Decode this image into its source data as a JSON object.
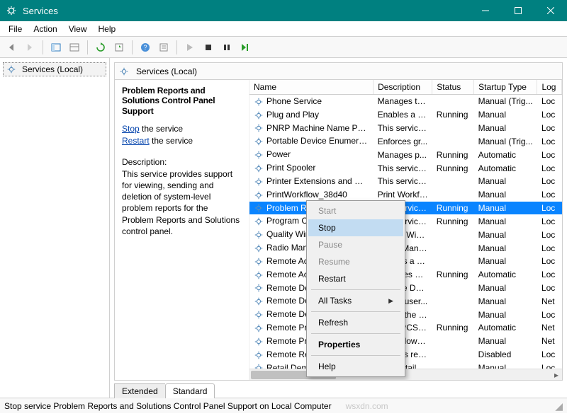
{
  "window": {
    "title": "Services"
  },
  "menus": {
    "file": "File",
    "action": "Action",
    "view": "View",
    "help": "Help"
  },
  "left": {
    "label": "Services (Local)"
  },
  "panel_header": "Services (Local)",
  "tabs": {
    "extended": "Extended",
    "standard": "Standard"
  },
  "desc": {
    "title": "Problem Reports and Solutions Control Panel Support",
    "stop_link": "Stop",
    "stop_suffix": " the service",
    "restart_link": "Restart",
    "restart_suffix": " the service",
    "label": "Description:",
    "text": "This service provides support for viewing, sending and deletion of system-level problem reports for the Problem Reports and Solutions control panel."
  },
  "columns": {
    "name": "Name",
    "description": "Description",
    "status": "Status",
    "startup": "Startup Type",
    "logon": "Log"
  },
  "context": {
    "start": "Start",
    "stop": "Stop",
    "pause": "Pause",
    "resume": "Resume",
    "restart": "Restart",
    "alltasks": "All Tasks",
    "refresh": "Refresh",
    "properties": "Properties",
    "help": "Help"
  },
  "status_text": "Stop service Problem Reports and Solutions Control Panel Support on Local Computer",
  "services": [
    {
      "name": "Phone Service",
      "desc": "Manages th...",
      "status": "",
      "startup": "Manual (Trig...",
      "logon": "Loc"
    },
    {
      "name": "Plug and Play",
      "desc": "Enables a c...",
      "status": "Running",
      "startup": "Manual",
      "logon": "Loc"
    },
    {
      "name": "PNRP Machine Name Publi...",
      "desc": "This service ...",
      "status": "",
      "startup": "Manual",
      "logon": "Loc"
    },
    {
      "name": "Portable Device Enumerator...",
      "desc": "Enforces gr...",
      "status": "",
      "startup": "Manual (Trig...",
      "logon": "Loc"
    },
    {
      "name": "Power",
      "desc": "Manages p...",
      "status": "Running",
      "startup": "Automatic",
      "logon": "Loc"
    },
    {
      "name": "Print Spooler",
      "desc": "This service ...",
      "status": "Running",
      "startup": "Automatic",
      "logon": "Loc"
    },
    {
      "name": "Printer Extensions and Notif...",
      "desc": "This service ...",
      "status": "",
      "startup": "Manual",
      "logon": "Loc"
    },
    {
      "name": "PrintWorkflow_38d40",
      "desc": "Print Workfl...",
      "status": "",
      "startup": "Manual",
      "logon": "Loc"
    },
    {
      "name": "Problem Reports and Soluti...",
      "desc": "This service ...",
      "status": "Running",
      "startup": "Manual",
      "logon": "Loc"
    },
    {
      "name": "Program Compatibility Assi...",
      "desc": "This service ...",
      "status": "Running",
      "startup": "Manual",
      "logon": "Loc"
    },
    {
      "name": "Quality Windows Audio Vid...",
      "desc": "Quality Win...",
      "status": "",
      "startup": "Manual",
      "logon": "Loc"
    },
    {
      "name": "Radio Management Service",
      "desc": "Radio Mana...",
      "status": "",
      "startup": "Manual",
      "logon": "Loc"
    },
    {
      "name": "Remote Access Auto Conne...",
      "desc": "Creates a co...",
      "status": "",
      "startup": "Manual",
      "logon": "Loc"
    },
    {
      "name": "Remote Access Connection...",
      "desc": "Manages di...",
      "status": "Running",
      "startup": "Automatic",
      "logon": "Loc"
    },
    {
      "name": "Remote Desktop Configurat...",
      "desc": "Remote Des...",
      "status": "",
      "startup": "Manual",
      "logon": "Loc"
    },
    {
      "name": "Remote Desktop Services",
      "desc": "Allows user...",
      "status": "",
      "startup": "Manual",
      "logon": "Net"
    },
    {
      "name": "Remote Desktop Services U...",
      "desc": "Allows the r...",
      "status": "",
      "startup": "Manual",
      "logon": "Loc"
    },
    {
      "name": "Remote Procedure Call (RP...",
      "desc": "The RPCSS ...",
      "status": "Running",
      "startup": "Automatic",
      "logon": "Net"
    },
    {
      "name": "Remote Procedure Call (RP...",
      "desc": "In Windows...",
      "status": "",
      "startup": "Manual",
      "logon": "Net"
    },
    {
      "name": "Remote Registry",
      "desc": "Enables rem...",
      "status": "",
      "startup": "Disabled",
      "logon": "Loc"
    },
    {
      "name": "Retail Demo Service",
      "desc": "The Retail D...",
      "status": "",
      "startup": "Manual",
      "logon": "Loc"
    }
  ],
  "watermark": "wsxdn.com"
}
